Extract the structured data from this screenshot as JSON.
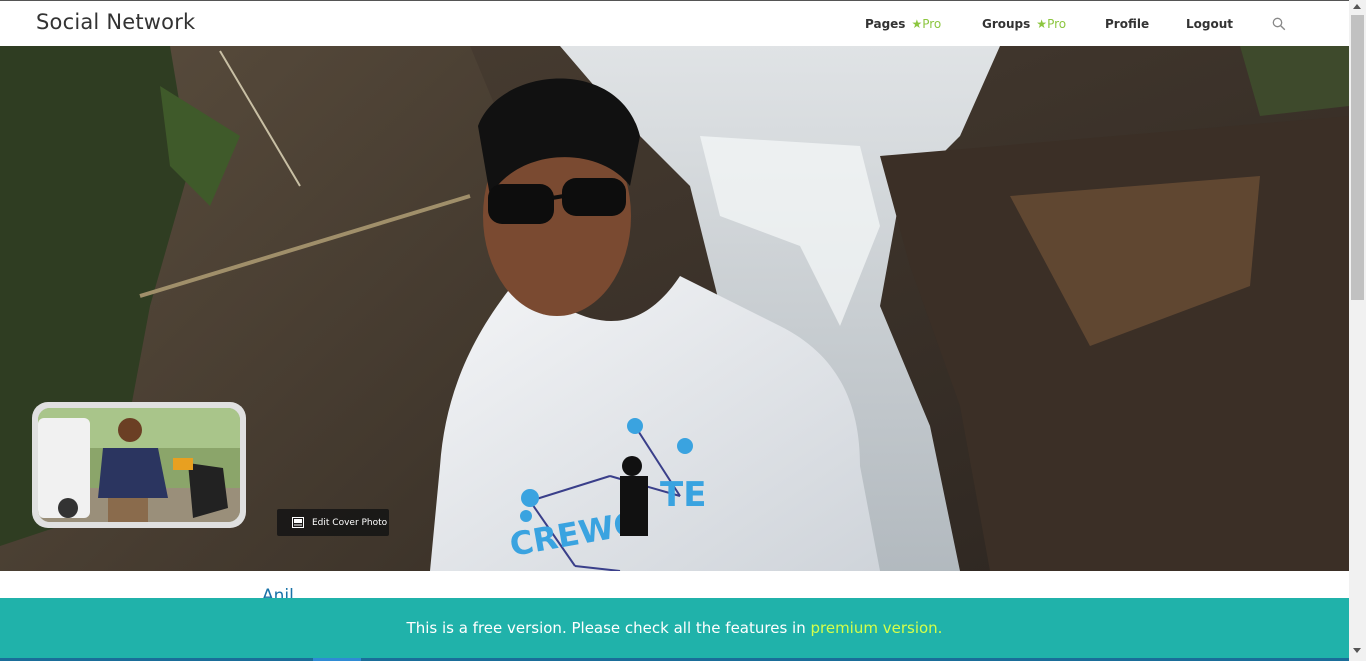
{
  "header": {
    "brand": "Social Network",
    "nav": [
      {
        "label": "Pages",
        "badge": "Pro"
      },
      {
        "label": "Groups",
        "badge": "Pro"
      },
      {
        "label": "Profile"
      },
      {
        "label": "Logout"
      }
    ],
    "search_icon": "search-icon"
  },
  "profile": {
    "edit_cover_label": "Edit Cover Photo",
    "name": "Anil"
  },
  "banner": {
    "text": "This is a free version. Please check all the features in ",
    "link": "premium version."
  },
  "colors": {
    "accent": "#8cc63f",
    "banner_bg": "#20b2aa",
    "link_highlight": "#d4ff4a"
  }
}
